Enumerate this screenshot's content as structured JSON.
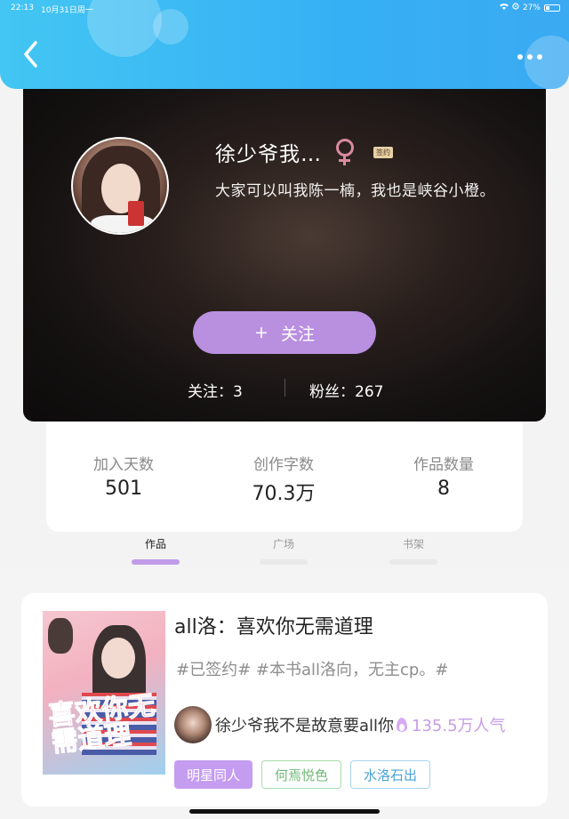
{
  "status_bar": {
    "time": "22:13",
    "date": "10月31日周一",
    "battery": "27%"
  },
  "profile": {
    "name": "徐少爷我…",
    "signed_badge": "签约",
    "bio": "大家可以叫我陈一楠，我也是峡谷小橙。",
    "follow_button": "关注",
    "follow_plus": "+",
    "following_text": "关注：3",
    "fans_text": "粉丝：267"
  },
  "stats": [
    {
      "label": "加入天数",
      "value": "501"
    },
    {
      "label": "创作字数",
      "value": "70.3万"
    },
    {
      "label": "作品数量",
      "value": "8"
    }
  ],
  "tabs": [
    {
      "label": "作品",
      "active": true
    },
    {
      "label": "广场",
      "active": false
    },
    {
      "label": "书架",
      "active": false
    }
  ],
  "book": {
    "title": "all洛：喜欢你无需道理",
    "tags": "#已签约# #本书all洛向，无主cp。#",
    "author": "徐少爷我不是故意要all你",
    "popularity": "135.5万人气",
    "chips": [
      "明星同人",
      "何焉悦色",
      "水洛石出"
    ],
    "cover_art_text": "喜欢你无需道理"
  },
  "colors": {
    "header": "#3ab4f4",
    "accent_purple": "#b98fe0",
    "chip_green": "#6fb878",
    "chip_blue": "#4aa3d6"
  },
  "icons": {
    "back": "chevron-left-icon",
    "more": "more-dots-icon",
    "gender": "female-icon",
    "fire": "fire-icon"
  }
}
